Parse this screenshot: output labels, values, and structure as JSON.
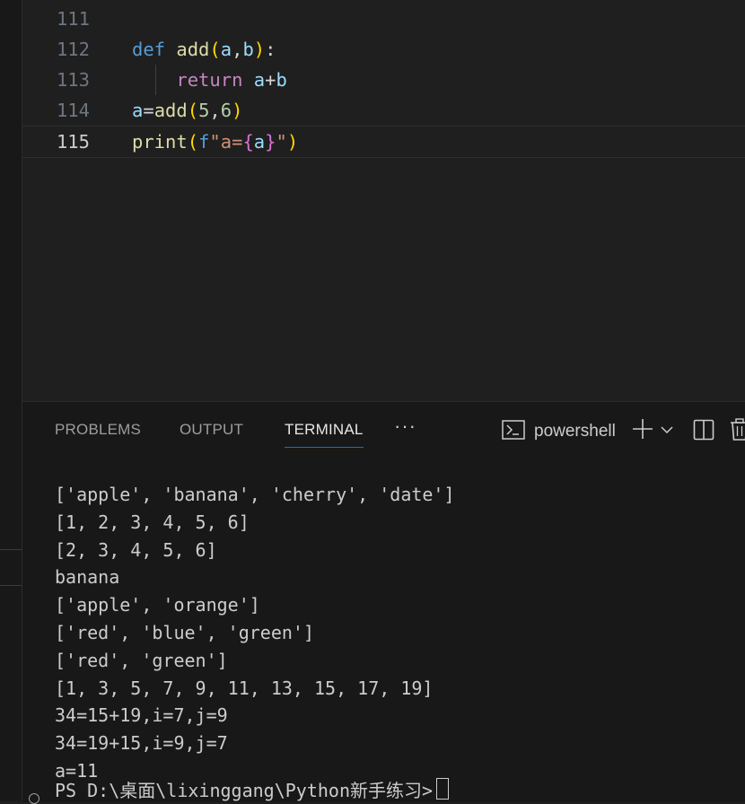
{
  "editor": {
    "lines": [
      {
        "number": "111",
        "current": false,
        "tokens": []
      },
      {
        "number": "112",
        "current": false,
        "tokens": [
          {
            "text": "def",
            "cls": "kw-def"
          },
          {
            "text": " ",
            "cls": "plain"
          },
          {
            "text": "add",
            "cls": "fn"
          },
          {
            "text": "(",
            "cls": "br1"
          },
          {
            "text": "a",
            "cls": "var"
          },
          {
            "text": ",",
            "cls": "plain"
          },
          {
            "text": "b",
            "cls": "var"
          },
          {
            "text": ")",
            "cls": "br1"
          },
          {
            "text": ":",
            "cls": "plain"
          }
        ]
      },
      {
        "number": "113",
        "current": false,
        "tokens": [
          {
            "text": "    ",
            "cls": "plain"
          },
          {
            "text": "return",
            "cls": "kw-return"
          },
          {
            "text": " ",
            "cls": "plain"
          },
          {
            "text": "a",
            "cls": "var"
          },
          {
            "text": "+",
            "cls": "plain"
          },
          {
            "text": "b",
            "cls": "var"
          }
        ]
      },
      {
        "number": "114",
        "current": false,
        "tokens": [
          {
            "text": "a",
            "cls": "var"
          },
          {
            "text": "=",
            "cls": "plain"
          },
          {
            "text": "add",
            "cls": "fn"
          },
          {
            "text": "(",
            "cls": "br1"
          },
          {
            "text": "5",
            "cls": "num"
          },
          {
            "text": ",",
            "cls": "plain"
          },
          {
            "text": "6",
            "cls": "num"
          },
          {
            "text": ")",
            "cls": "br1"
          }
        ]
      },
      {
        "number": "115",
        "current": true,
        "tokens": [
          {
            "text": "print",
            "cls": "fn"
          },
          {
            "text": "(",
            "cls": "br1"
          },
          {
            "text": "f",
            "cls": "kw-def"
          },
          {
            "text": "\"a=",
            "cls": "str"
          },
          {
            "text": "{",
            "cls": "br2"
          },
          {
            "text": "a",
            "cls": "var"
          },
          {
            "text": "}",
            "cls": "br2"
          },
          {
            "text": "\"",
            "cls": "str"
          },
          {
            "text": ")",
            "cls": "br1"
          }
        ]
      }
    ]
  },
  "panel": {
    "tabs": [
      "PROBLEMS",
      "OUTPUT",
      "TERMINAL"
    ],
    "active_tab": "TERMINAL",
    "more_label": "···",
    "shell_name": "powershell",
    "icons": [
      "terminal-icon",
      "plus-icon",
      "chevron-down-icon",
      "split-icon",
      "trash-icon"
    ]
  },
  "terminal": {
    "output": [
      "['apple', 'banana', 'cherry', 'date']",
      "[1, 2, 3, 4, 5, 6]",
      "[2, 3, 4, 5, 6]",
      "banana",
      "['apple', 'orange']",
      "['red', 'blue', 'green']",
      "['red', 'green']",
      "[1, 3, 5, 7, 9, 11, 13, 15, 17, 19]",
      "34=15+19,i=7,j=9",
      "34=19+15,i=9,j=7",
      "a=11"
    ],
    "prompt": "PS D:\\桌面\\lixinggang\\Python新手练习>"
  },
  "colors": {
    "editor_bg": "#1f1f1f",
    "panel_bg": "#181818",
    "accent": "#0078d4"
  }
}
